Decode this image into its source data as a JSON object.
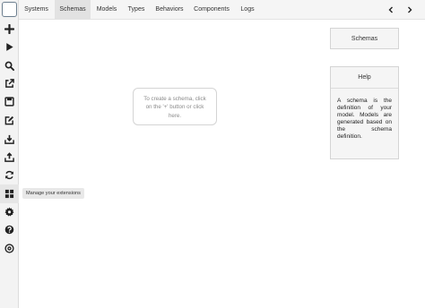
{
  "tabs": [
    {
      "label": "Systems",
      "active": false
    },
    {
      "label": "Schemas",
      "active": true
    },
    {
      "label": "Models",
      "active": false
    },
    {
      "label": "Types",
      "active": false
    },
    {
      "label": "Behaviors",
      "active": false
    },
    {
      "label": "Components",
      "active": false
    },
    {
      "label": "Logs",
      "active": false
    }
  ],
  "sidebar": {
    "icons": [
      "app-logo-icon",
      "plus-icon",
      "play-icon",
      "search-icon",
      "export-icon",
      "save-icon",
      "edit-icon",
      "download-icon",
      "upload-icon",
      "sync-icon",
      "extensions-icon",
      "gear-icon",
      "help-icon",
      "info-icon"
    ]
  },
  "nav": {
    "prev_icon": "chevron-left-icon",
    "next_icon": "chevron-right-icon"
  },
  "canvas": {
    "hint_line1": "To create a schema, click",
    "hint_line2": "on the '+' button or click",
    "hint_line3": "here."
  },
  "schemas_panel": {
    "title": "Schemas"
  },
  "help_panel": {
    "title": "Help",
    "body": "A schema is the definition of your model. Models are generated based on the schema definition."
  },
  "tooltip": {
    "text": "Manage your extensions"
  },
  "colors": {
    "icon": "#222222",
    "tab_active_bg": "#e2e2e2",
    "panel_bg": "#f5f5f5",
    "border": "#d4d4d4"
  }
}
